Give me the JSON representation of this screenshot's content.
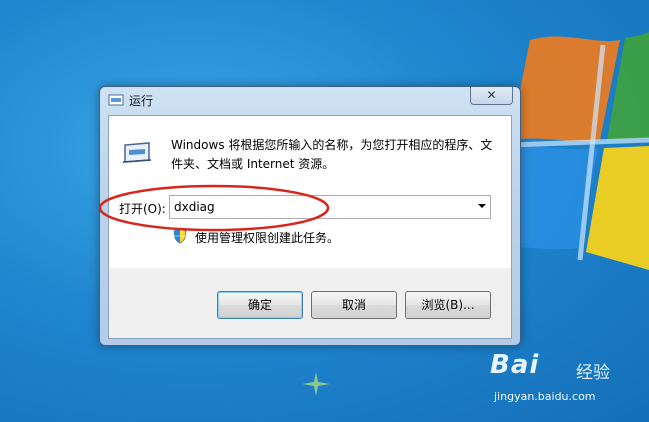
{
  "dialog": {
    "title": "运行",
    "close_glyph": "✕",
    "description": "Windows 将根据您所输入的名称，为您打开相应的程序、文件夹、文档或 Internet 资源。",
    "open_label": "打开(O):",
    "open_value": "dxdiag",
    "admin_note": "使用管理权限创建此任务。",
    "buttons": {
      "ok": "确定",
      "cancel": "取消",
      "browse": "浏览(B)..."
    },
    "icons": {
      "title": "run-icon",
      "content": "run-icon",
      "admin": "uac-shield-icon"
    }
  },
  "annotation": {
    "type": "ellipse",
    "color": "#d9261c"
  },
  "watermark": {
    "brand": "Bai",
    "suffix": "经验",
    "url": "jingyan.baidu.com"
  }
}
